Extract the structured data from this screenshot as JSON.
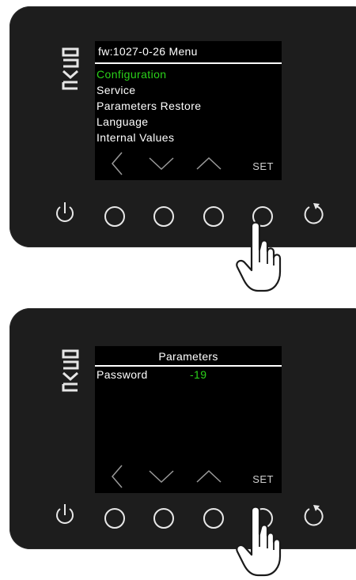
{
  "colors": {
    "panel": "#1d1d1d",
    "screen_bg": "#000000",
    "highlight": "#2bd21a",
    "text": "#ffffff"
  },
  "panels": [
    {
      "logo": "EVCO",
      "screen_title": "fw:1027-0-26 Menu",
      "menu_items": [
        {
          "label": "Configuration",
          "selected": true
        },
        {
          "label": "Service",
          "selected": false
        },
        {
          "label": "Parameters Restore",
          "selected": false
        },
        {
          "label": "Language",
          "selected": false
        },
        {
          "label": "Internal Values",
          "selected": false
        }
      ],
      "softkeys": [
        "chevron-left-icon",
        "chevron-down-icon",
        "chevron-up-icon",
        "SET"
      ],
      "hardware_buttons": [
        "power-icon",
        "button-1",
        "button-2",
        "button-3",
        "button-4",
        "refresh-icon"
      ],
      "pressed_button": "button-4"
    },
    {
      "logo": "EVCO",
      "screen_title": "Parameters",
      "param_label": "Password",
      "param_value": "-19",
      "softkeys": [
        "chevron-left-icon",
        "chevron-down-icon",
        "chevron-up-icon",
        "SET"
      ],
      "hardware_buttons": [
        "power-icon",
        "button-1",
        "button-2",
        "button-3",
        "button-4",
        "refresh-icon"
      ],
      "pressed_button": "button-4"
    }
  ]
}
